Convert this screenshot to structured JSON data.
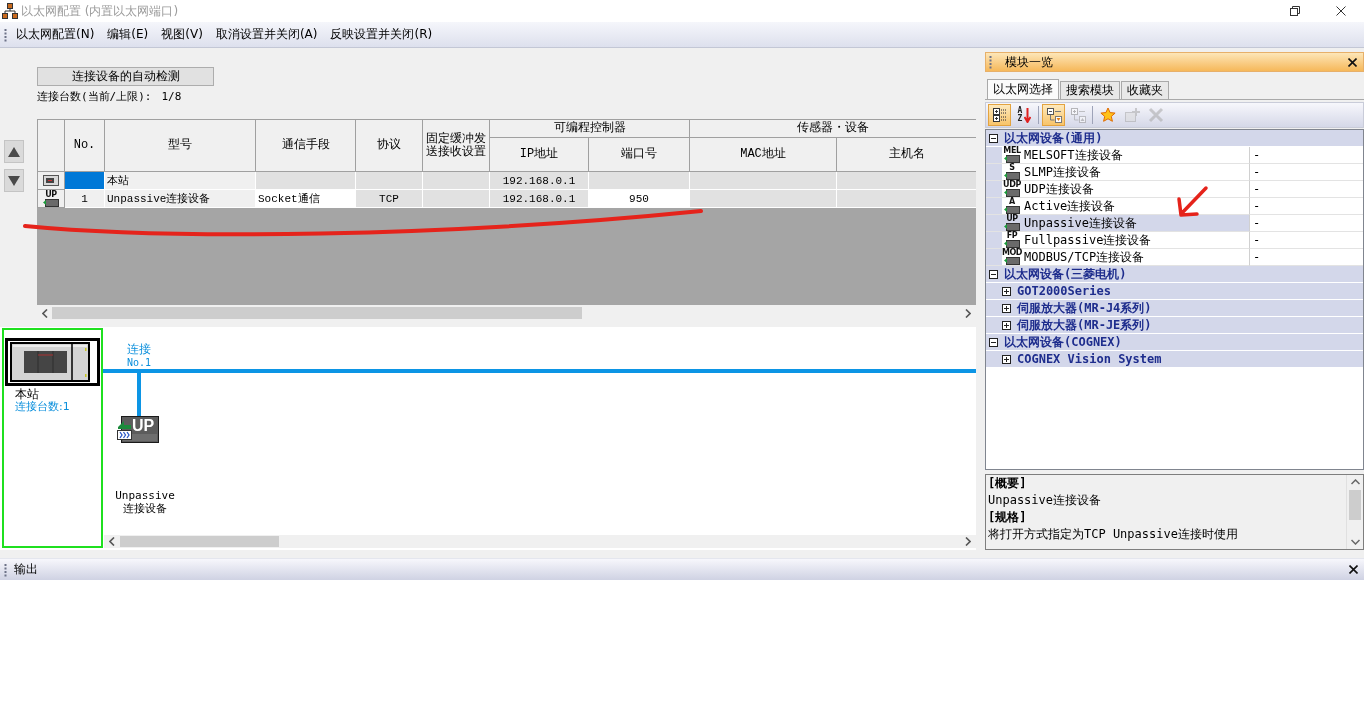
{
  "window": {
    "title": "以太网配置 (内置以太网端口)"
  },
  "menu": [
    {
      "label": "以太网配置(N)"
    },
    {
      "label": "编辑(E)"
    },
    {
      "label": "视图(V)"
    },
    {
      "label": "取消设置并关闭(A)"
    },
    {
      "label": "反映设置并关闭(R)"
    }
  ],
  "detect_button": {
    "label": "连接设备的自动检测"
  },
  "connection_count": {
    "label": "连接台数(当前/上限):",
    "value": "1/8"
  },
  "table": {
    "columns": [
      "No.",
      "型号",
      "通信手段",
      "协议",
      "固定缓冲发送接收设置"
    ],
    "column_groups": [
      {
        "label": "可编程控制器",
        "columns": [
          "IP地址",
          "端口号"
        ]
      },
      {
        "label": "传感器・设备",
        "columns": [
          "MAC地址",
          "主机名"
        ]
      }
    ],
    "rows": [
      {
        "kind": "station",
        "cells": [
          {
            "kind": "plain",
            "selected": true
          },
          {
            "text": "本站",
            "kind": "plain",
            "selected": false
          },
          {
            "kind": "locked",
            "selected": false
          },
          {
            "kind": "locked",
            "selected": false
          },
          {
            "kind": "locked",
            "selected": false
          },
          {
            "text": "192.168.0.1",
            "kind": "locked",
            "selected": false
          },
          {
            "kind": "locked",
            "selected": false
          },
          {
            "kind": "locked",
            "selected": false
          },
          {
            "kind": "locked",
            "selected": false
          }
        ]
      },
      {
        "kind": "device",
        "badge": "UP",
        "cells": [
          {
            "text": "1",
            "kind": "plain",
            "selected": false
          },
          {
            "text": "Unpassive连接设备",
            "kind": "plain",
            "selected": false
          },
          {
            "text": "Socket通信",
            "kind": "input",
            "selected": false
          },
          {
            "text": "TCP",
            "kind": "locked",
            "selected": false
          },
          {
            "kind": "locked",
            "selected": false
          },
          {
            "text": "192.168.0.1",
            "kind": "locked",
            "selected": false
          },
          {
            "text": "950",
            "kind": "input",
            "selected": false
          },
          {
            "kind": "locked",
            "selected": false
          },
          {
            "kind": "locked",
            "selected": false
          }
        ]
      }
    ]
  },
  "diagram": {
    "station": {
      "label": "本站",
      "count": "连接台数:1",
      "selected": true
    },
    "devices": [
      {
        "link_label": "连接",
        "link_number": "No.1",
        "badge": "UP",
        "label": "Unpassive连接设备"
      }
    ]
  },
  "module_list": {
    "title": "模块一览",
    "tabs": [
      {
        "label": "以太网选择",
        "selected": true
      },
      {
        "label": "搜索模块",
        "selected": false
      },
      {
        "label": "收藏夹",
        "selected": false
      }
    ],
    "toolbar": [
      {
        "kind": "category-view",
        "selected": true,
        "disabled": false
      },
      {
        "kind": "sort",
        "glyph": "AZ",
        "selected": false,
        "disabled": false
      },
      {
        "kind": "expand-all",
        "selected": true,
        "disabled": false
      },
      {
        "kind": "collapse-all",
        "selected": false,
        "disabled": true
      },
      {
        "kind": "favorite",
        "selected": false,
        "disabled": false
      },
      {
        "kind": "add",
        "selected": false,
        "disabled": true
      },
      {
        "kind": "delete",
        "selected": false,
        "disabled": true
      }
    ],
    "tree": [
      {
        "label": "以太网设备(通用)",
        "expanded": true,
        "selected": false,
        "children": [
          {
            "kind": "device",
            "badge": "MEL",
            "label": "MELSOFT连接设备",
            "value": "-",
            "selected": false
          },
          {
            "kind": "device",
            "badge": "S",
            "label": "SLMP连接设备",
            "value": "-",
            "selected": false
          },
          {
            "kind": "device",
            "badge": "UDP",
            "label": "UDP连接设备",
            "value": "-",
            "selected": false
          },
          {
            "kind": "device",
            "badge": "A",
            "label": "Active连接设备",
            "value": "-",
            "selected": false
          },
          {
            "kind": "device",
            "badge": "UP",
            "label": "Unpassive连接设备",
            "value": "-",
            "selected": true
          },
          {
            "kind": "device",
            "badge": "FP",
            "label": "Fullpassive连接设备",
            "value": "-",
            "selected": false
          },
          {
            "kind": "device",
            "badge": "MOD",
            "label": "MODBUS/TCP连接设备",
            "value": "-",
            "selected": false
          }
        ]
      },
      {
        "label": "以太网设备(三菱电机)",
        "expanded": true,
        "selected": false,
        "children": [
          {
            "kind": "group",
            "label": "GOT2000Series",
            "expanded": false,
            "selected": false
          },
          {
            "kind": "group",
            "label": "伺服放大器(MR-J4系列)",
            "expanded": false,
            "selected": false
          },
          {
            "kind": "group",
            "label": "伺服放大器(MR-JE系列)",
            "expanded": false,
            "selected": false
          }
        ]
      },
      {
        "label": "以太网设备(COGNEX)",
        "expanded": true,
        "selected": false,
        "children": [
          {
            "kind": "group",
            "label": "COGNEX Vision System",
            "expanded": false,
            "selected": false
          }
        ]
      }
    ],
    "description": [
      {
        "heading": "[概要]",
        "text": "Unpassive连接设备"
      },
      {
        "heading": "[规格]",
        "text": "将打开方式指定为TCP Unpassive连接时使用"
      }
    ]
  },
  "output": {
    "title": "输出"
  },
  "annotations": [
    {
      "kind": "underline"
    },
    {
      "kind": "arrow"
    }
  ]
}
